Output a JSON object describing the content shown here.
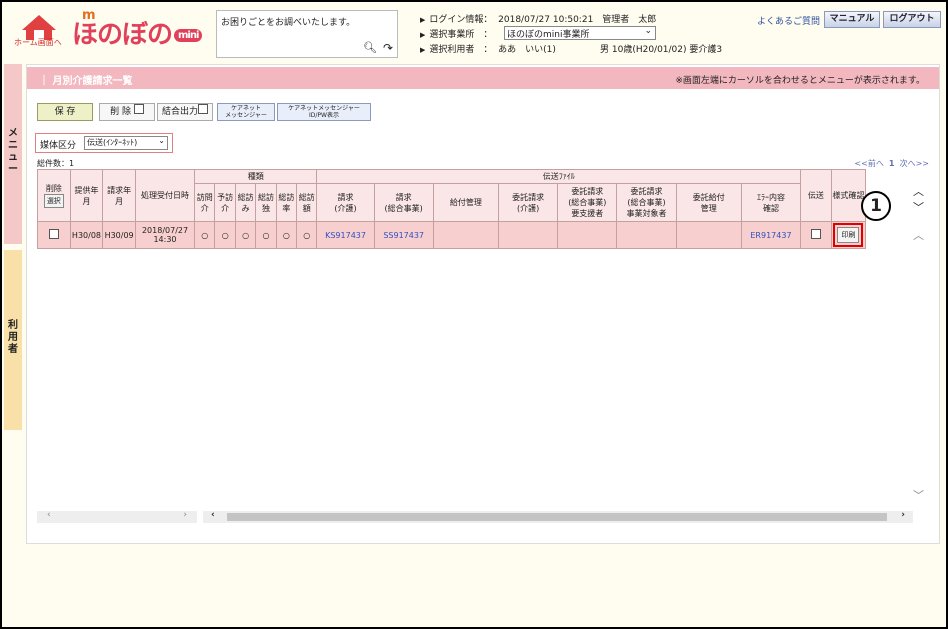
{
  "header": {
    "home_label": "ホーム画面へ",
    "logo": "ほのぼの",
    "logo_mini": "mini",
    "search_placeholder": "お困りごとをお調べいたします。",
    "login_label": "ログイン情報：",
    "login_value": "2018/07/27 10:50:21　管理者　太郎",
    "office_label": "選択事業所　：",
    "office_value": "ほのぼのmini事業所",
    "user_label": "選択利用者　：",
    "user_value": "ああ　いい(1)",
    "user_detail": "男 10歳(H20/01/02) 要介護3",
    "faq": "よくあるご質問",
    "manual": "マニュアル",
    "logout": "ログアウト"
  },
  "sidebar": {
    "menu": "メニュー",
    "user": "利用者"
  },
  "main": {
    "title": "月別介護請求一覧",
    "note": "※画面左端にカーソルを合わせるとメニューが表示されます。",
    "buttons": {
      "save": "保 存",
      "delete": "削 除",
      "merge": "結合出力",
      "caremanager": "ケアネット\nメッセンジャー",
      "caremsg": "ケアネットメッセンジャー\nID/PW表示"
    },
    "media_label": "媒体区分",
    "media_value": "伝送(ｲﾝﾀｰﾈｯﾄ)",
    "total": "総件数：1",
    "pager_prev": "<<前へ",
    "pager_page": "1",
    "pager_next": "次へ>>"
  },
  "table": {
    "group_type": "種類",
    "group_file": "伝送ﾌｧｲﾙ",
    "h_delete": "削除",
    "h_select": "選択",
    "h_provide": "提供年月",
    "h_claim": "請求年月",
    "h_received": "処理受付日時",
    "types": [
      "訪問介",
      "予訪介",
      "総訪み",
      "総訪独",
      "総訪率",
      "総訪額"
    ],
    "files": [
      "請求\n(介護)",
      "請求\n(総合事業)",
      "給付管理",
      "委託請求\n(介護)",
      "委託請求\n(総合事業)\n要支援者",
      "委託請求\n(総合事業)\n事業対象者",
      "委託給付\n管理",
      "ｴﾗｰ内容\n確認"
    ],
    "h_send": "伝送",
    "h_form": "様式確認",
    "row": {
      "provide": "H30/08",
      "claim": "H30/09",
      "received": "2018/07/27\n14:30",
      "types": [
        "○",
        "○",
        "○",
        "○",
        "○",
        "○"
      ],
      "file1": "KS917437",
      "file2": "SS917437",
      "err": "ER917437",
      "print": "印刷"
    }
  },
  "callout": "1"
}
